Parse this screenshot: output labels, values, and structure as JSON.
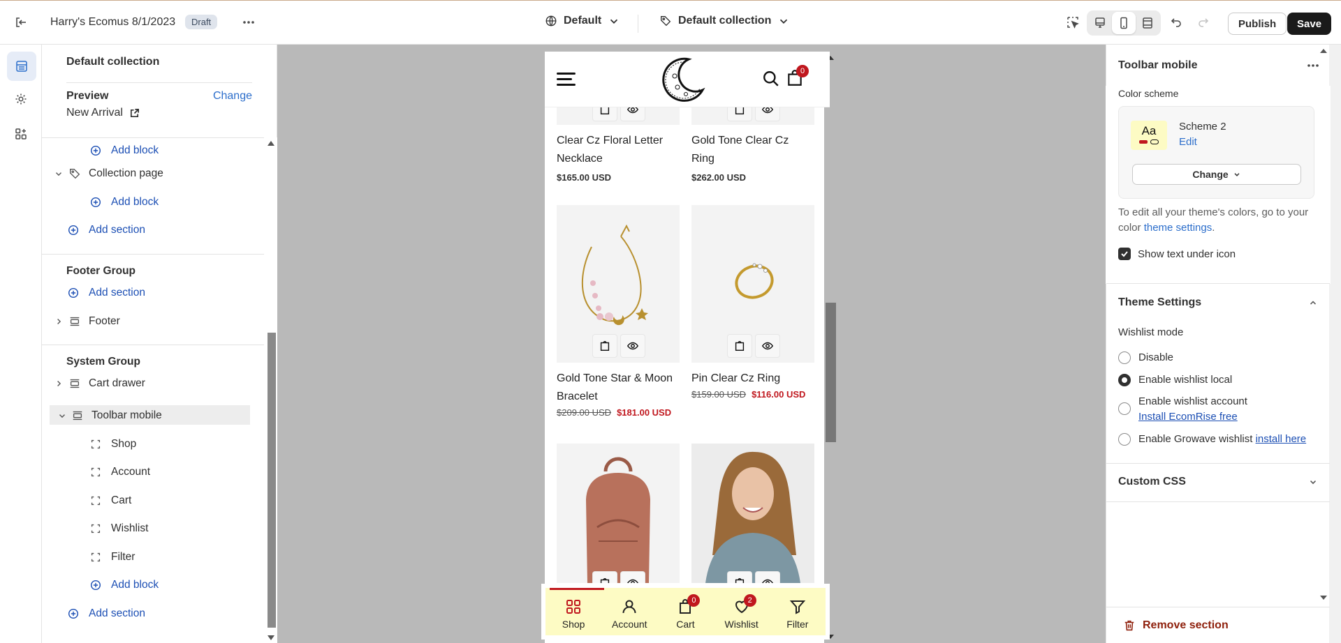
{
  "topbar": {
    "store_title": "Harry's Ecomus 8/1/2023",
    "status_badge": "Draft",
    "theme_select": "Default",
    "template_select": "Default collection",
    "publish_label": "Publish",
    "save_label": "Save"
  },
  "left_panel": {
    "title": "Default collection",
    "preview_label": "Preview",
    "change_link": "Change",
    "preview_value": "New Arrival",
    "tree": {
      "add_block_1": "Add block",
      "collection_page": "Collection page",
      "add_block_2": "Add block",
      "add_section_1": "Add section",
      "footer_group": "Footer Group",
      "add_section_2": "Add section",
      "footer": "Footer",
      "system_group": "System Group",
      "cart_drawer": "Cart drawer",
      "toolbar_mobile": "Toolbar mobile",
      "children": [
        "Shop",
        "Account",
        "Cart",
        "Wishlist",
        "Filter"
      ],
      "add_block_3": "Add block",
      "add_section_3": "Add section"
    }
  },
  "preview": {
    "cart_count": "0",
    "products": [
      {
        "name": "Clear Cz Floral Letter Necklace",
        "price": "$165.00 USD"
      },
      {
        "name": "Gold Tone Clear Cz Ring",
        "price": "$262.00 USD"
      },
      {
        "name": "Gold Tone Star & Moon Bracelet",
        "old_price": "$209.00 USD",
        "sale_price": "$181.00 USD"
      },
      {
        "name": "Pin Clear Cz Ring",
        "old_price": "$159.00 USD",
        "sale_price": "$116.00 USD"
      }
    ],
    "toolbar": {
      "shop": "Shop",
      "account": "Account",
      "cart": "Cart",
      "cart_badge": "0",
      "wishlist": "Wishlist",
      "wishlist_badge": "2",
      "filter": "Filter"
    }
  },
  "right_panel": {
    "title": "Toolbar mobile",
    "color_scheme_label": "Color scheme",
    "scheme_swatch": "Aa",
    "scheme_name": "Scheme 2",
    "edit_link": "Edit",
    "change_button": "Change",
    "note_prefix": "To edit all your theme's colors, go to your color ",
    "note_link": "theme settings",
    "note_suffix": ".",
    "show_text_label": "Show text under icon",
    "theme_settings_title": "Theme Settings",
    "wishlist_mode_label": "Wishlist mode",
    "radio_disable": "Disable",
    "radio_local": "Enable wishlist local",
    "radio_account": "Enable wishlist account",
    "install_ecomrise": "Install EcomRise free",
    "radio_growave": "Enable Growave wishlist",
    "install_here": "install here",
    "custom_css_title": "Custom CSS",
    "remove_section": "Remove section"
  },
  "colors": {
    "accent_blue": "#2c6ecb",
    "brand_red": "#c0171e",
    "highlight_yellow": "#fdfbc4",
    "danger": "#8e1f0b"
  }
}
